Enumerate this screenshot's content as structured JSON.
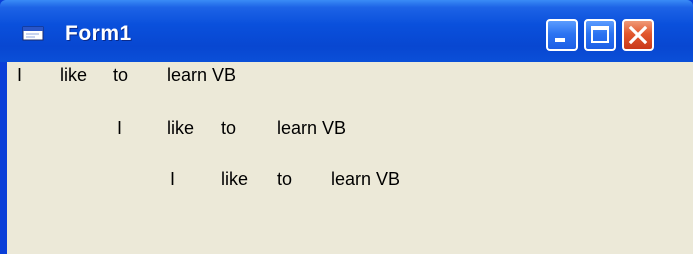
{
  "window": {
    "title": "Form1",
    "icon": "form-window-icon",
    "controls": {
      "minimize_icon": "minimize-icon",
      "maximize_icon": "maximize-icon",
      "close_icon": "close-icon"
    }
  },
  "output_lines": [
    {
      "words": [
        "I",
        "like",
        "to",
        "learn VB"
      ]
    },
    {
      "words": [
        "I",
        "like",
        "to",
        "learn VB"
      ]
    },
    {
      "words": [
        "I",
        "like",
        "to",
        "learn VB"
      ]
    }
  ],
  "colors": {
    "titlebar": "#0a50dc",
    "client_background": "#ece9d8",
    "close_button": "#e2582e"
  }
}
